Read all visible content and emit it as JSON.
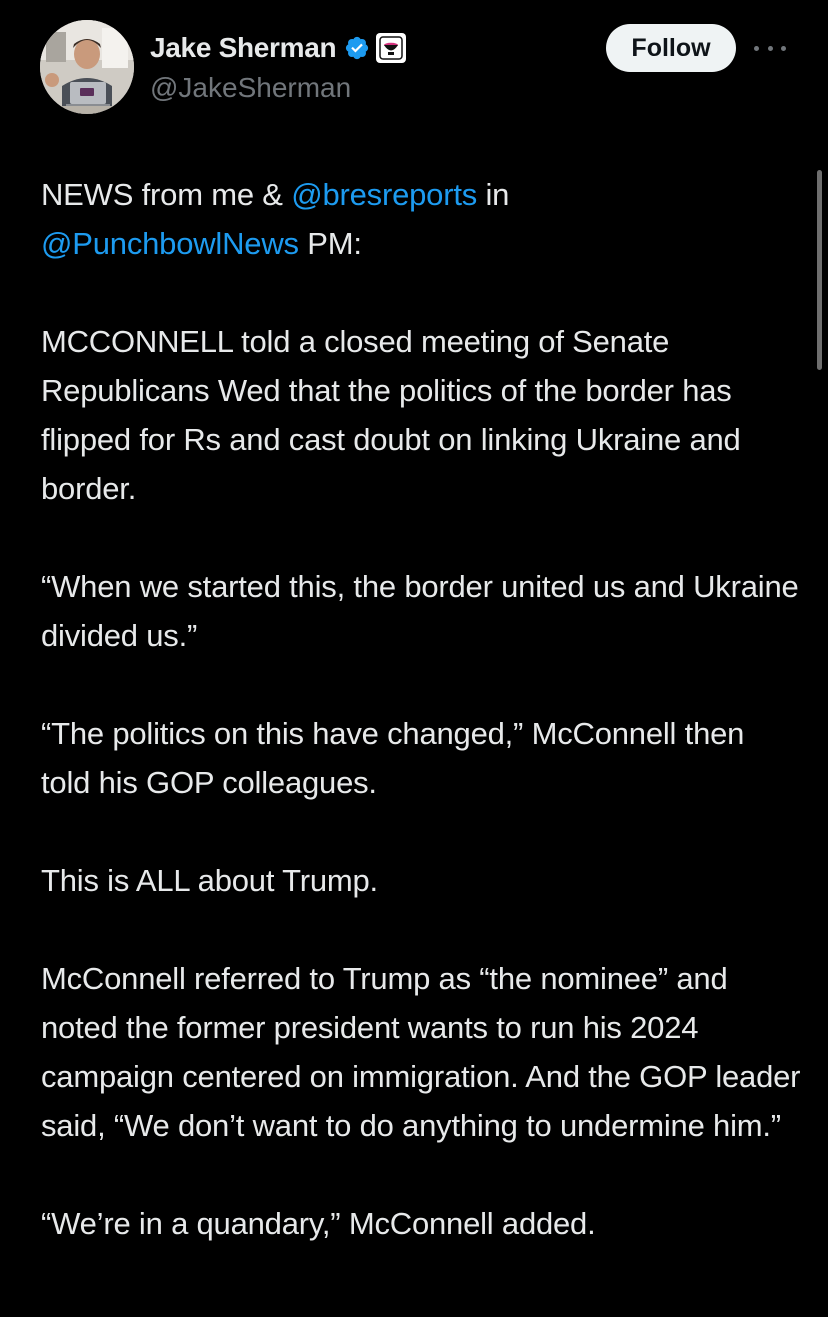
{
  "author": {
    "name": "Jake Sherman",
    "handle": "@JakeSherman",
    "verified": true,
    "affiliate_badge": "punchbowl-news-badge-icon"
  },
  "actions": {
    "follow_label": "Follow",
    "more_icon": "more-horizontal-icon"
  },
  "tweet": {
    "intro": {
      "part1": "NEWS from me & ",
      "mention1": "@bresreports",
      "part2": " in",
      "mention2": "@PunchbowlNews",
      "part3": " PM:"
    },
    "paragraphs": [
      "MCCONNELL told a closed meeting of Senate Republicans Wed that the politics of the border has flipped for Rs and cast doubt on linking Ukraine and border.",
      "“When we started this, the border united us and Ukraine divided us.”",
      "“The politics on this have changed,” McConnell then told his GOP colleagues.",
      "This is ALL about Trump.",
      "McConnell referred to Trump as “the nominee” and noted the former president wants to run his 2024 campaign centered on immigration. And the GOP leader said, “We don’t want to do anything to undermine him.”",
      "“We’re in a quandary,” McConnell added."
    ]
  },
  "colors": {
    "background": "#000000",
    "text": "#e7e9ea",
    "secondary_text": "#71767b",
    "link": "#1d9bf0",
    "verified_blue": "#1d9bf0",
    "follow_button_bg": "#eff3f4"
  }
}
